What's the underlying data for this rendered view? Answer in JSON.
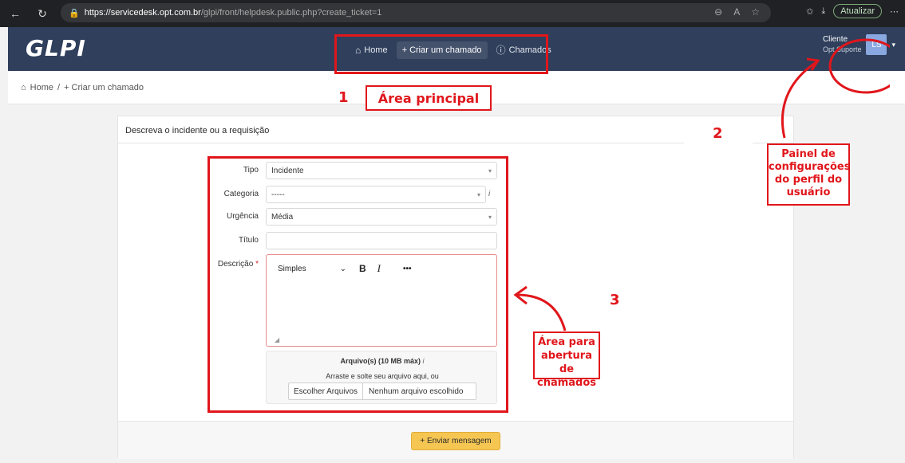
{
  "browser": {
    "url_host": "https://servicedesk.opt.com.br",
    "url_path": "/glpi/front/helpdesk.public.php?create_ticket=1",
    "update_label": "Atualizar"
  },
  "header": {
    "logo": "GLPI",
    "nav": [
      {
        "label": "Home"
      },
      {
        "label": "+ Criar um chamado"
      },
      {
        "label": "Chamados"
      }
    ],
    "profile_name": "Cliente",
    "profile_sub": "Opt Suporte",
    "avatar_initials": "LS"
  },
  "breadcrumb": {
    "home": "Home",
    "sep": "/",
    "current": "+ Criar um chamado"
  },
  "form": {
    "heading": "Descreva o incidente ou a requisição",
    "tipo_label": "Tipo",
    "tipo_value": "Incidente",
    "categoria_label": "Categoria",
    "categoria_value": "-----",
    "urgencia_label": "Urgência",
    "urgencia_value": "Média",
    "titulo_label": "Título",
    "titulo_value": "",
    "descricao_label": "Descrição",
    "required_mark": "*",
    "editor_format": "Simples",
    "editor_bold": "B",
    "editor_italic": "I",
    "editor_more": "•••",
    "files_title": "Arquivo(s) (10 MB máx)",
    "files_hint": "Arraste e solte seu arquivo aqui, ou",
    "choose_files": "Escolher Arquivos",
    "no_file": "Nenhum arquivo escolhido",
    "submit": "+ Enviar mensagem"
  },
  "annotations": {
    "num1": "1",
    "num2": "2",
    "num3": "3",
    "title1": "Área principal",
    "label2": "Painel de configurações do perfil do usuário",
    "label3": "Área para abertura de chamados"
  },
  "colors": {
    "header_bg": "#2f3f5c",
    "annotation_red": "#e0161b",
    "submit_bg": "#f6c653"
  }
}
